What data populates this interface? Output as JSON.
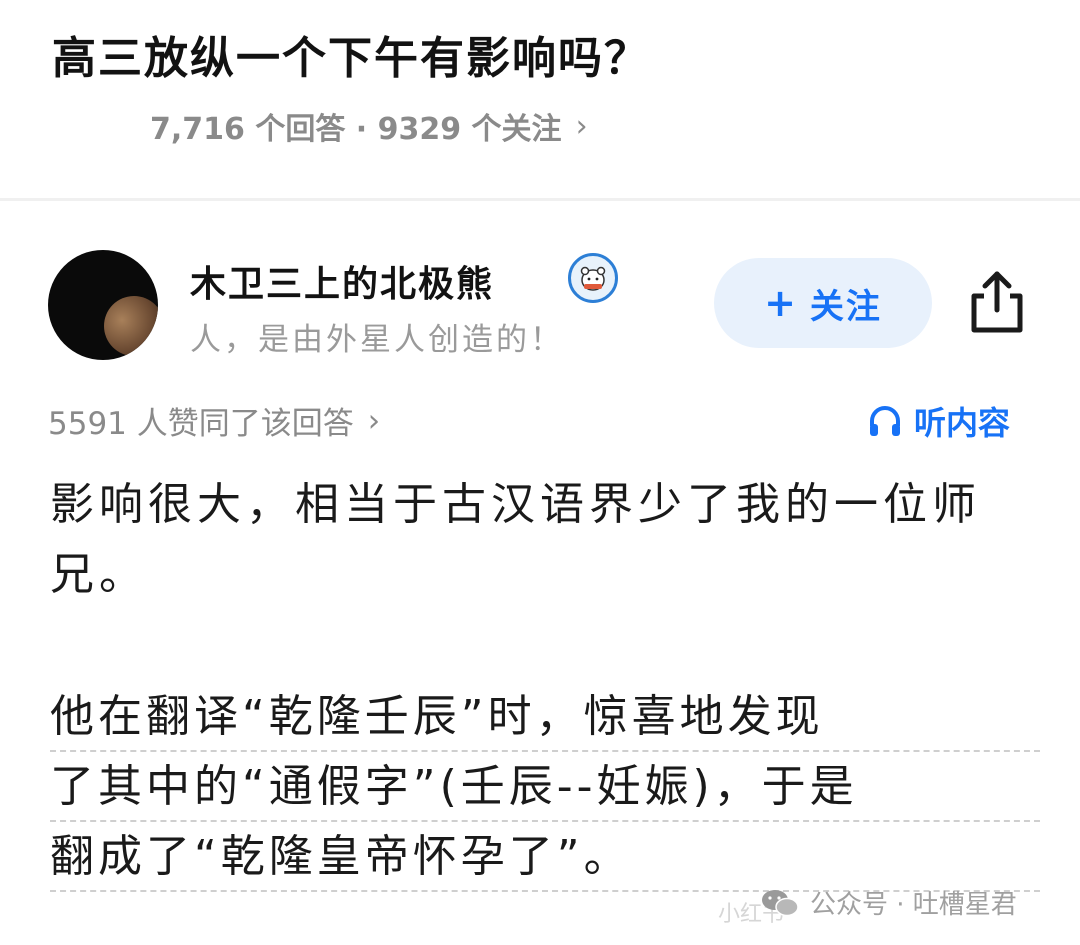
{
  "question": {
    "title": "高三放纵一个下午有影响吗？",
    "meta": "7,716 个回答 · 9329 个关注",
    "meta_chevron": "›"
  },
  "author": {
    "name": "木卫三上的北极熊",
    "signature": "人，是由外星人创造的！",
    "badge_icon": "polar-bear-badge-icon"
  },
  "actions": {
    "follow_plus": "+",
    "follow_label": "关注",
    "share_icon": "share-icon"
  },
  "answer": {
    "votes": "5591 人赞同了该回答",
    "votes_chevron": "›",
    "listen_label": "听内容",
    "paragraph1": "影响很大，相当于古汉语界少了我的一位师兄。",
    "paragraph2_lines": [
      "他在翻译“乾隆壬辰”时，惊喜地发现",
      "了其中的“通假字”(壬辰--妊娠)，于是",
      "翻成了“乾隆皇帝怀孕了”。"
    ]
  },
  "watermark": {
    "label": "公众号 · 吐槽星君",
    "faint": "小红书"
  },
  "colors": {
    "accent": "#1772f6",
    "follow_bg": "#e8f1fc",
    "meta_text": "#8a8a8a",
    "divider": "#f0f0f0"
  }
}
